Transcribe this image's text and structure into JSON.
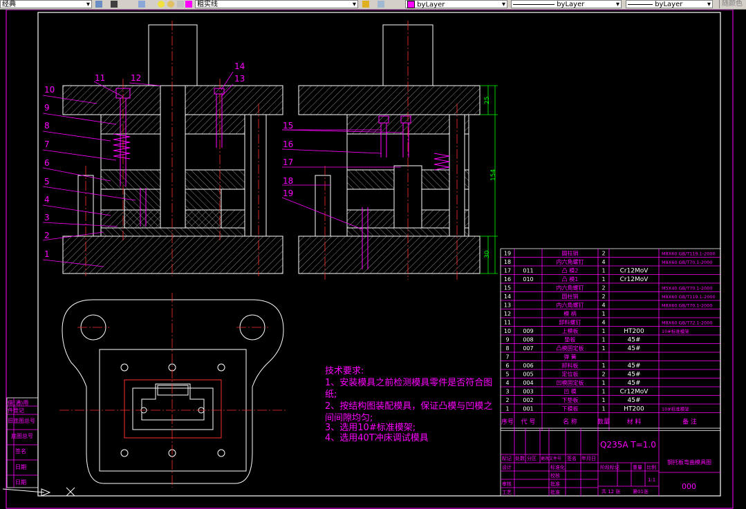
{
  "toolbar": {
    "workspace": "经典",
    "linetype_combo": "粗实线",
    "color_combo": "byLayer",
    "linetype_bylayer": "byLayer",
    "lineweight_bylayer": "byLayer",
    "extra_button": "随颜色"
  },
  "drawing": {
    "callouts_left": [
      "10",
      "9",
      "8",
      "7",
      "6",
      "5",
      "4",
      "3",
      "2",
      "1"
    ],
    "callouts_top": [
      "11",
      "12",
      "14",
      "13"
    ],
    "callouts_right": [
      "15",
      "16",
      "17",
      "18",
      "19"
    ],
    "dimensions": [
      "25",
      "154",
      "30"
    ],
    "tech_requirements": {
      "heading": "技术要求:",
      "line1": "1、安装模具之前检测模具零件是否符合图",
      "line1b": "纸;",
      "line2": "2、按结构图装配模具，保证凸模与凹模之",
      "line2b": "间间隙均匀;",
      "line3": "3、选用10#标准模架;",
      "line4": "4、选用40T冲床调试模具"
    },
    "bom_rows": [
      {
        "no": "19",
        "code": "",
        "name": "圆柱销",
        "qty": "2",
        "mat": "",
        "note": "M8X60 GB/T119.1-2000"
      },
      {
        "no": "18",
        "code": "",
        "name": "内六角螺钉",
        "qty": "4",
        "mat": "",
        "note": "M8X60 GB/T70.1-2000"
      },
      {
        "no": "17",
        "code": "011",
        "name": "凸 模2",
        "qty": "1",
        "mat": "Cr12MoV",
        "note": ""
      },
      {
        "no": "16",
        "code": "010",
        "name": "凸 模1",
        "qty": "1",
        "mat": "Cr12MoV",
        "note": ""
      },
      {
        "no": "15",
        "code": "",
        "name": "内六角螺钉",
        "qty": "2",
        "mat": "",
        "note": "M5X40 GB/T70.1-2000"
      },
      {
        "no": "14",
        "code": "",
        "name": "圆柱销",
        "qty": "2",
        "mat": "",
        "note": "M8X60 GB/T119.1-2000"
      },
      {
        "no": "13",
        "code": "",
        "name": "内六角螺钉",
        "qty": "4",
        "mat": "",
        "note": "M8X60 GB/T70.1-2000"
      },
      {
        "no": "12",
        "code": "",
        "name": "模 柄",
        "qty": "1",
        "mat": "",
        "note": ""
      },
      {
        "no": "11",
        "code": "",
        "name": "卸料螺钉",
        "qty": "4",
        "mat": "",
        "note": "M8X60 GB/T72.1-2000"
      },
      {
        "no": "10",
        "code": "009",
        "name": "上模板",
        "qty": "1",
        "mat": "HT200",
        "note": "10#标准模架"
      },
      {
        "no": "9",
        "code": "008",
        "name": "垫板",
        "qty": "1",
        "mat": "45#",
        "note": ""
      },
      {
        "no": "8",
        "code": "007",
        "name": "凸模固定板",
        "qty": "1",
        "mat": "45#",
        "note": ""
      },
      {
        "no": "7",
        "code": "",
        "name": "弹 簧",
        "qty": "",
        "mat": "",
        "note": ""
      },
      {
        "no": "6",
        "code": "006",
        "name": "卸料板",
        "qty": "1",
        "mat": "45#",
        "note": ""
      },
      {
        "no": "5",
        "code": "005",
        "name": "定位板",
        "qty": "2",
        "mat": "45#",
        "note": ""
      },
      {
        "no": "4",
        "code": "004",
        "name": "凹模固定板",
        "qty": "1",
        "mat": "45#",
        "note": ""
      },
      {
        "no": "3",
        "code": "003",
        "name": "凹 模",
        "qty": "1",
        "mat": "Cr12MoV",
        "note": ""
      },
      {
        "no": "2",
        "code": "002",
        "name": "下垫板",
        "qty": "1",
        "mat": "45#",
        "note": ""
      },
      {
        "no": "1",
        "code": "001",
        "name": "下模板",
        "qty": "1",
        "mat": "HT200",
        "note": "10#标准模架"
      }
    ],
    "bom_header": {
      "no": "序号",
      "code": "代 号",
      "name": "名 称",
      "qty": "数量",
      "mat": "材 料",
      "note": "备 注"
    },
    "title_block": {
      "material": "Q235A  T=1.0",
      "drawing_name": "钢托板弯曲模具图",
      "row_labels": [
        "标记",
        "处数",
        "分区",
        "更改文件号",
        "签名",
        "年月日"
      ],
      "design": "设计",
      "std": "标准化",
      "review": "审核",
      "craft": "工艺",
      "check": "校核",
      "approve": "批准",
      "stage": "阶段标记",
      "weight": "重量",
      "scale": "比例",
      "scale_value": "1:1",
      "sheets_total": "共 12 张",
      "sheet_no": "第01张",
      "drawing_code": "000"
    },
    "left_strip": [
      "借(通)用",
      "件登记",
      "旧底图总号",
      "底图总号",
      "签名",
      "日期",
      "日期"
    ]
  }
}
